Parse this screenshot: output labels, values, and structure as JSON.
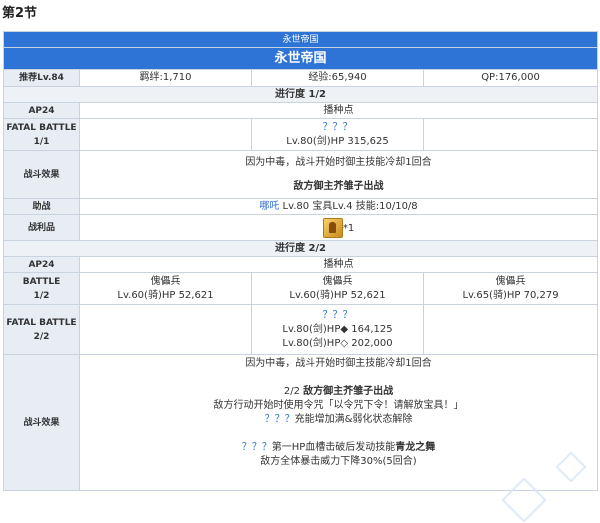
{
  "section_title": "第2节",
  "header": {
    "sub": "永世帝国",
    "main": "永世帝国"
  },
  "info": {
    "label": "推荐Lv.84",
    "bond": "羁绊:1,710",
    "exp": "经验:65,940",
    "qp": "QP:176,000"
  },
  "progress1": {
    "title": "进行度 1/2",
    "ap_label": "AP24",
    "ap_value": "播种点",
    "battle_label": "FATAL BATTLE",
    "battle_num": "1/1",
    "enemy_name": "？？？",
    "enemy_stats": "Lv.80(剑)HP 315,625",
    "effects_label": "战斗效果",
    "effect1": "因为中毒，战斗开始时御主技能冷却1回合",
    "effect2": "敌方御主芥雏子出战",
    "support_label": "助战",
    "support_name": "哪吒",
    "support_stats": " Lv.80 宝具Lv.4 技能:10/10/8",
    "loot_label": "战利品",
    "loot_count": "*1"
  },
  "progress2": {
    "title": "进行度 2/2",
    "ap_label": "AP24",
    "ap_value": "播种点",
    "battle1_label": "BATTLE",
    "battle1_num": "1/2",
    "enemies": [
      {
        "name": "傀儡兵",
        "stats": "Lv.60(骑)HP 52,621"
      },
      {
        "name": "傀儡兵",
        "stats": "Lv.60(骑)HP 52,621"
      },
      {
        "name": "傀儡兵",
        "stats": "Lv.65(骑)HP 70,279"
      }
    ],
    "battle2_label": "FATAL BATTLE",
    "battle2_num": "2/2",
    "boss_name": "？？？",
    "boss_stat1": "Lv.80(剑)HP◆ 164,125",
    "boss_stat2": "Lv.80(剑)HP◇ 202,000",
    "effects_label": "战斗效果",
    "effect1": "因为中毒，战斗开始时御主技能冷却1回合",
    "effect2_prefix": "2/2 ",
    "effect2_bold": "敌方御主芥雏子出战",
    "effect3": "敌方行动开始时使用令咒「以令咒下令！请解放宝具！」",
    "effect4_name": "？？？",
    "effect4_text": "充能增加满&弱化状态解除",
    "effect5_name": "？？？",
    "effect5_text": "第一HP血槽击破后发动技能",
    "effect5_bold": "青龙之舞",
    "effect6": "敌方全体暴击威力下降30%(5回合)"
  },
  "colors": {
    "header": "#2e74d6",
    "label_bg": "#e8edf4",
    "border": "#c9d3e0",
    "link": "#2e6fd4"
  },
  "icons": {
    "loot": "gold-item-icon"
  }
}
